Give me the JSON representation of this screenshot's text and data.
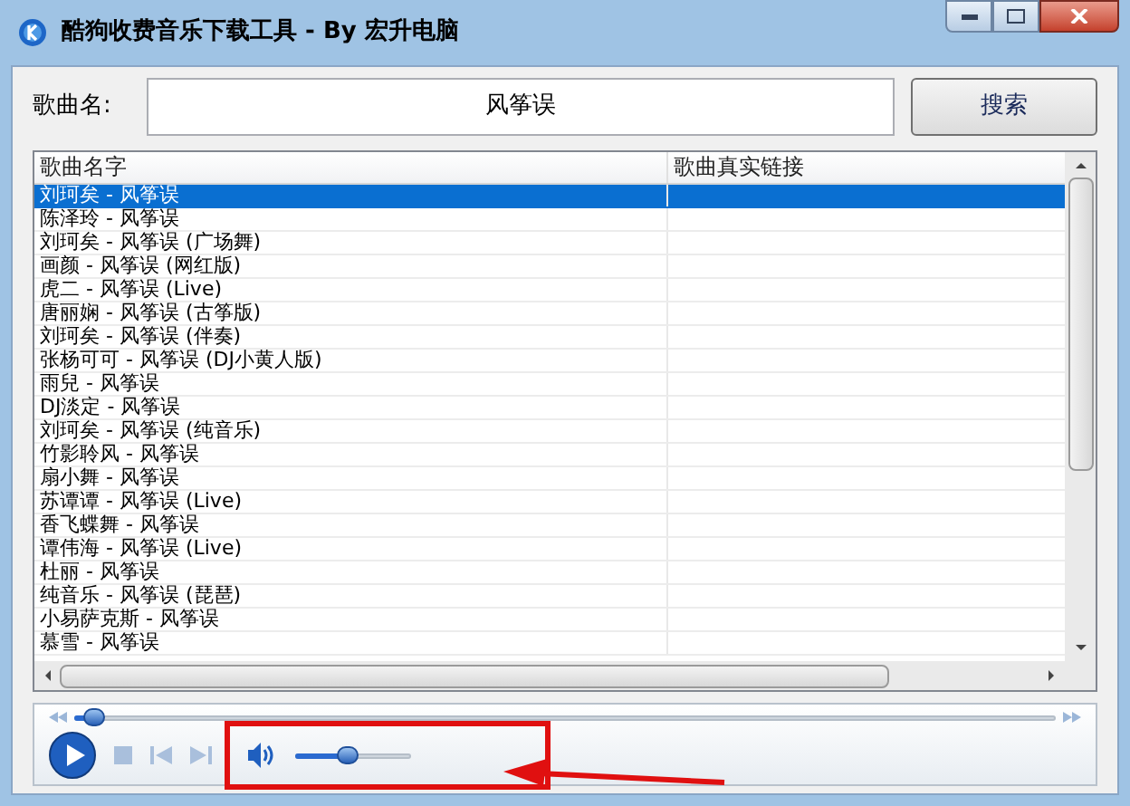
{
  "window": {
    "title": "酷狗收费音乐下载工具 - By 宏升电脑"
  },
  "search": {
    "label": "歌曲名:",
    "value": "风筝误",
    "button": "搜索"
  },
  "table": {
    "columns": [
      "歌曲名字",
      "歌曲真实链接"
    ],
    "rows": [
      {
        "name": "刘珂矣 - 风筝误",
        "selected": true
      },
      {
        "name": "陈泽玲 - 风筝误",
        "selected": false
      },
      {
        "name": "刘珂矣 - 风筝误 (广场舞)",
        "selected": false
      },
      {
        "name": "画颜 - 风筝误 (网红版)",
        "selected": false
      },
      {
        "name": "虎二 - 风筝误 (Live)",
        "selected": false
      },
      {
        "name": "唐丽娴 - 风筝误 (古筝版)",
        "selected": false
      },
      {
        "name": "刘珂矣 - 风筝误 (伴奏)",
        "selected": false
      },
      {
        "name": "张杨可可 - 风筝误 (DJ小黄人版)",
        "selected": false
      },
      {
        "name": "雨兒 - 风筝误",
        "selected": false
      },
      {
        "name": "DJ淡定 - 风筝误",
        "selected": false
      },
      {
        "name": "刘珂矣 - 风筝误 (纯音乐)",
        "selected": false
      },
      {
        "name": "竹影聆风 - 风筝误",
        "selected": false
      },
      {
        "name": "扇小舞 - 风筝误",
        "selected": false
      },
      {
        "name": "苏谭谭 - 风筝误 (Live)",
        "selected": false
      },
      {
        "name": "香飞蝶舞 - 风筝误",
        "selected": false
      },
      {
        "name": "谭伟海 - 风筝误 (Live)",
        "selected": false
      },
      {
        "name": "杜丽 - 风筝误",
        "selected": false
      },
      {
        "name": "纯音乐 - 风筝误 (琵琶)",
        "selected": false
      },
      {
        "name": "小易萨克斯 - 风筝误",
        "selected": false
      },
      {
        "name": "慕雪 - 风筝误",
        "selected": false
      }
    ]
  },
  "player": {
    "seek": {
      "level": 0.02
    },
    "volume": {
      "level": 0.45
    }
  }
}
